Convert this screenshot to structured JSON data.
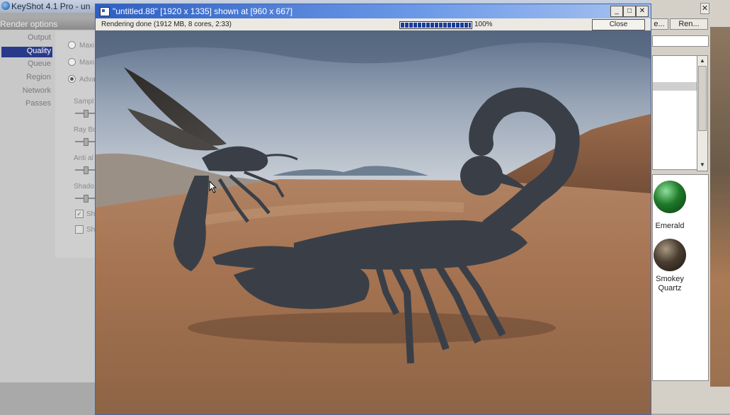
{
  "main_window": {
    "title": "KeyShot 4.1 Pro - un"
  },
  "render_options": {
    "header": "Render options",
    "nav": [
      {
        "label": "Output",
        "selected": false
      },
      {
        "label": "Quality",
        "selected": true
      },
      {
        "label": "Queue",
        "selected": false
      },
      {
        "label": "Region",
        "selected": false
      },
      {
        "label": "Network",
        "selected": false
      },
      {
        "label": "Passes",
        "selected": false
      }
    ],
    "radios": [
      "Maxi",
      "Maxi",
      "Adva"
    ],
    "sliders": [
      "Sampl",
      "Ray Bo",
      "Anti al",
      "Shado"
    ],
    "checkboxes": [
      {
        "label": "Sh",
        "checked": true
      },
      {
        "label": "Sh",
        "checked": false
      }
    ]
  },
  "right_panel": {
    "buttons": [
      "e...",
      "Ren..."
    ],
    "materials": [
      {
        "name": "Emerald",
        "color": "#1f7a2a"
      },
      {
        "name": "Smokey Quartz",
        "color": "#4a3d30"
      }
    ]
  },
  "render_window": {
    "title": "\"untitled.88\" [1920 x 1335] shown at [960 x 667]",
    "status": "Rendering done (1912 MB, 8 cores,  2:33)",
    "progress_fraction": 1.0,
    "progress_text": "100%",
    "close_label": "Close",
    "buttons": {
      "minimize": "_",
      "maximize": "□",
      "close": "✕"
    }
  },
  "colors": {
    "titlebar": "#2d5fc4",
    "selection": "#2a3a8a",
    "creature": "#3a3f47"
  }
}
